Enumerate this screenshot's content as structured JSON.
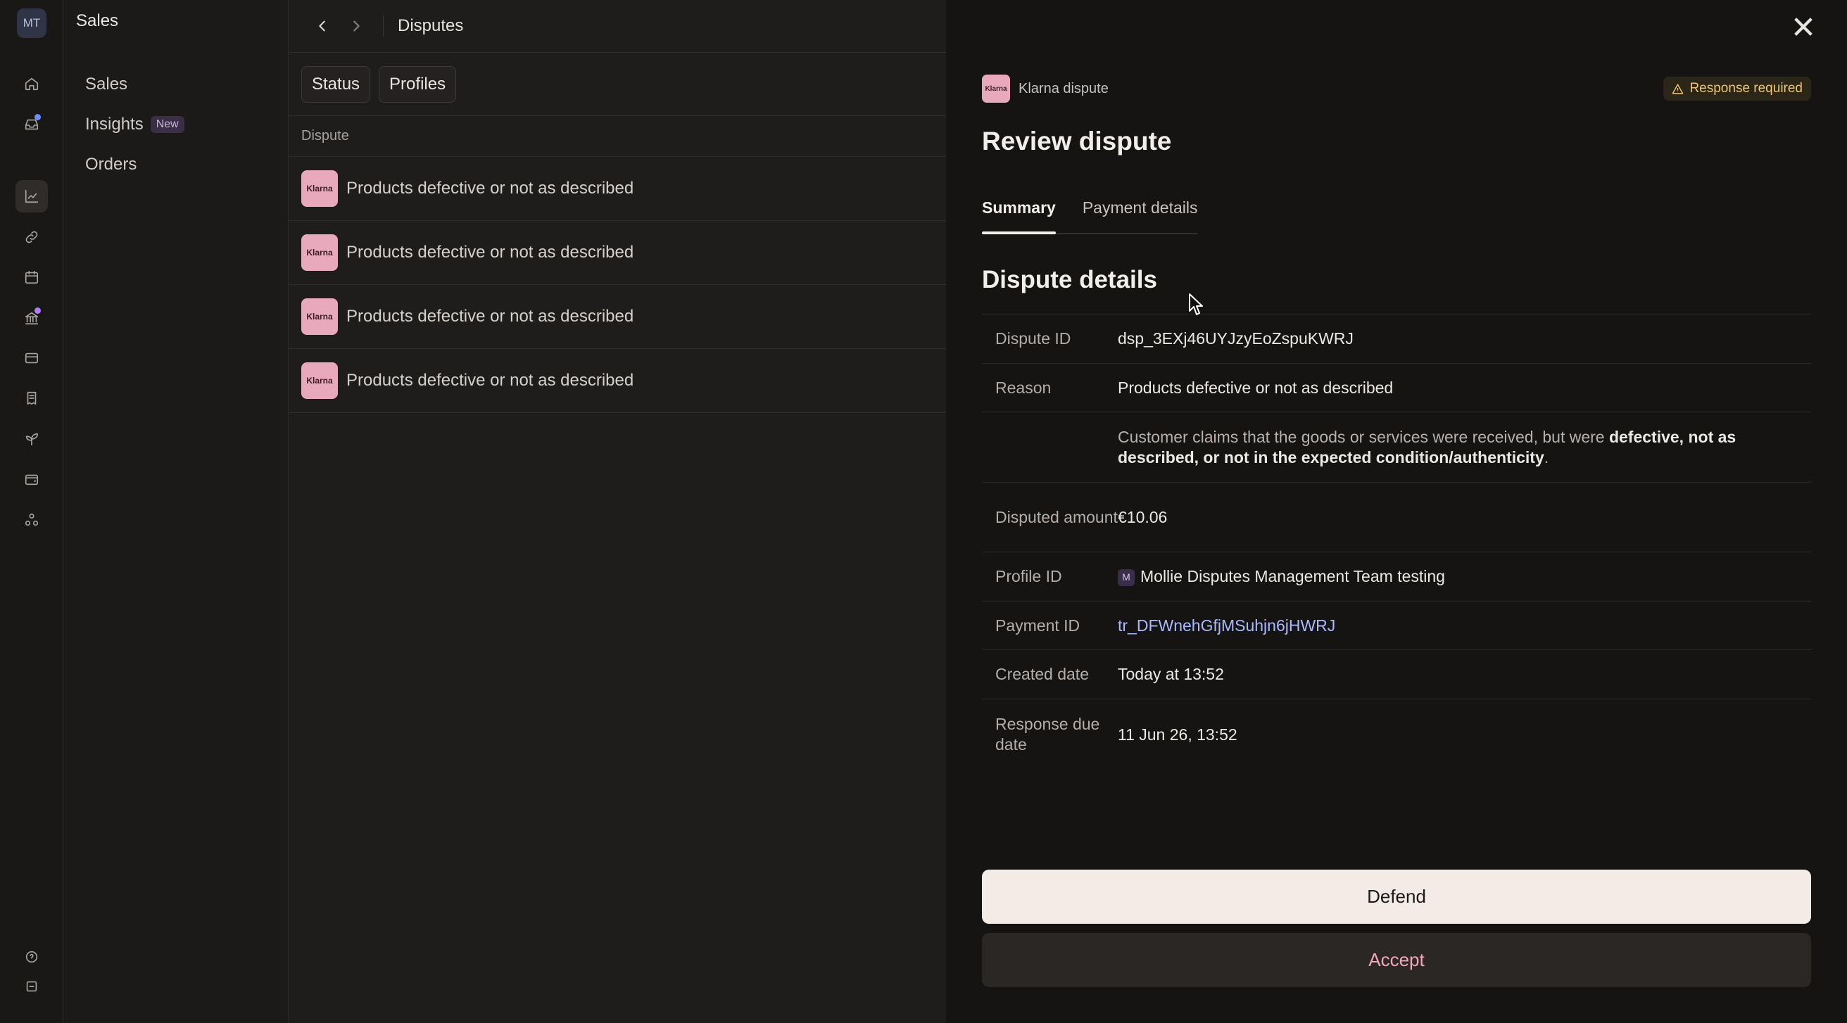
{
  "rail": {
    "avatar": "MT",
    "icons": [
      "home-icon",
      "inbox-icon",
      "chart-icon",
      "link-icon",
      "calendar-icon",
      "bank-icon",
      "card-icon",
      "receipt-icon",
      "plant-icon",
      "wallet-icon",
      "apps-icon",
      "help-icon",
      "settings-icon"
    ],
    "dot_colors": {
      "inbox": "#6c8cff",
      "bank": "#b07cff"
    }
  },
  "sidebar": {
    "title": "Sales",
    "items": [
      {
        "label": "Sales"
      },
      {
        "label": "Insights",
        "badge": "New"
      },
      {
        "label": "Orders"
      }
    ]
  },
  "list": {
    "breadcrumb": "Disputes",
    "filters": [
      "Status",
      "Profiles"
    ],
    "column_header": "Dispute",
    "logo_text": "Klarna",
    "rows": [
      "Products defective or not as described",
      "Products defective or not as described",
      "Products defective or not as described",
      "Products defective or not as described"
    ]
  },
  "drawer": {
    "provider": "Klarna dispute",
    "logo_text": "Klarna",
    "status_badge": "Response required",
    "title": "Review dispute",
    "tabs": [
      "Summary",
      "Payment details"
    ],
    "active_tab": "Summary",
    "section_title": "Dispute details",
    "details": {
      "dispute_id_label": "Dispute ID",
      "dispute_id": "dsp_3EXj46UYJzyEoZspuKWRJ",
      "reason_label": "Reason",
      "reason": "Products defective or not as described",
      "desc_prefix": "Customer claims that the goods or services were received, but were ",
      "desc_bold": "defective, not as described, or not in the expected condition/authenticity",
      "desc_suffix": ".",
      "amount_label": "Disputed amount",
      "amount": "€10.06",
      "profile_label": "Profile ID",
      "profile_initial": "M",
      "profile": "Mollie Disputes Management Team testing",
      "payment_label": "Payment ID",
      "payment_id": "tr_DFWnehGfjMSuhjn6jHWRJ",
      "created_label": "Created date",
      "created": "Today at 13:52",
      "due_label": "Response due date",
      "due": "11 Jun 26, 13:52"
    },
    "defend_label": "Defend",
    "accept_label": "Accept"
  },
  "colors": {
    "accent_link": "#a9b9ff",
    "accept_text": "#f0a6bd",
    "warning": "#f0c76a",
    "klarna_pink": "#e8a9bd"
  }
}
